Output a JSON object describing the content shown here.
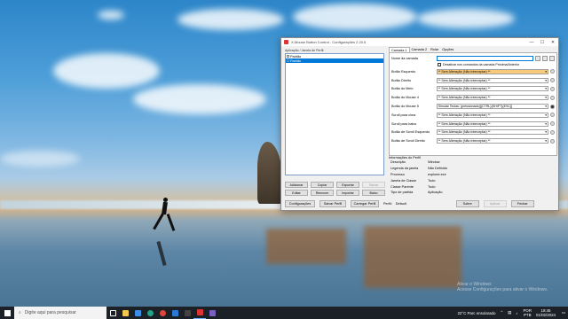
{
  "window": {
    "title": "X-Mouse Button Control - Configurações 2.20.5",
    "minimize_glyph": "—",
    "maximize_glyph": "☐",
    "close_glyph": "✕"
  },
  "left": {
    "heading": "Aplicação / Janela de Perfil:",
    "profiles": [
      "Padrão",
      "Padrão"
    ],
    "buttons": [
      {
        "label": "Adicionar",
        "enabled": true
      },
      {
        "label": "Copiar",
        "enabled": true
      },
      {
        "label": "Exportar",
        "enabled": true
      },
      {
        "label": "Salvar",
        "enabled": false
      },
      {
        "label": "Editar",
        "enabled": true
      },
      {
        "label": "Remover",
        "enabled": true
      },
      {
        "label": "Importar",
        "enabled": true
      },
      {
        "label": "Baixo",
        "enabled": true
      }
    ]
  },
  "tabs": [
    "Camada 1",
    "Camada 2",
    "Rolar",
    "Opções"
  ],
  "layer": {
    "name_label": "Nome da camada",
    "name_value": "",
    "disable_check_label": "Desativar nos comandos da camada Próxima/Anterior"
  },
  "buttons": [
    {
      "label": "Botão Esquerdo",
      "value": "** Sem Alteração (Não interceptar) **",
      "highlight": true
    },
    {
      "label": "Botão Direito",
      "value": "** Sem Alteração (Não interceptar) **",
      "highlight": false
    },
    {
      "label": "Botão do Meio",
      "value": "** Sem Alteração (Não interceptar) **",
      "highlight": false
    },
    {
      "label": "Botão do Mouse 4",
      "value": "** Sem Alteração (Não interceptar) **",
      "highlight": false
    },
    {
      "label": "Botão do Mouse 5",
      "value": "Simular Teclas: (pressionado)[{CTRL}{SHIFT}{ESC}]",
      "highlight": false
    },
    {
      "label": "Scroll para cima",
      "value": "** Sem Alteração (Não interceptar) **",
      "highlight": false
    },
    {
      "label": "Scroll para baixo",
      "value": "** Sem Alteração (Não interceptar) **",
      "highlight": false
    },
    {
      "label": "Botão de Scroll Esquerdo",
      "value": "** Sem Alteração (Não interceptar) **",
      "highlight": false
    },
    {
      "label": "Botão de Scroll Direito",
      "value": "** Sem Alteração (Não interceptar) **",
      "highlight": false
    }
  ],
  "profile_info": {
    "title": "Informações do Perfil",
    "rows": [
      {
        "key": "Descrição",
        "value": "Window"
      },
      {
        "key": "Legenda da janela",
        "value": "Não Definido"
      },
      {
        "key": "Processo",
        "value": "explorer.exe"
      },
      {
        "key": "Janela de Classe",
        "value": "Tudo"
      },
      {
        "key": "Classe Parente",
        "value": "Tudo"
      },
      {
        "key": "Tipo de partida",
        "value": "Aplicação"
      }
    ]
  },
  "bottom": {
    "settings": "Configurações",
    "save_profile": "Salvar Perfil",
    "load_profile": "Carregar Perfil",
    "profile_label": "Perfil:",
    "profile_value": "Default",
    "about": "Sobre",
    "apply": "Aplicar",
    "close": "Fechar"
  },
  "watermark": [
    "Ativar o Windows",
    "Acesse Configurações para ativar o Windows."
  ],
  "taskbar": {
    "search_placeholder": "Digite aqui para pesquisar",
    "weather": "22°C  Parc ensolarado",
    "lang_top": "POR",
    "lang_bottom": "PTB",
    "time": "18:45",
    "date": "01/02/2024",
    "apps": [
      "file-explorer-icon",
      "store-icon",
      "edge-icon",
      "chrome-icon",
      "photos-icon",
      "terminal-icon",
      "xmouse-icon",
      "other-icon"
    ]
  }
}
